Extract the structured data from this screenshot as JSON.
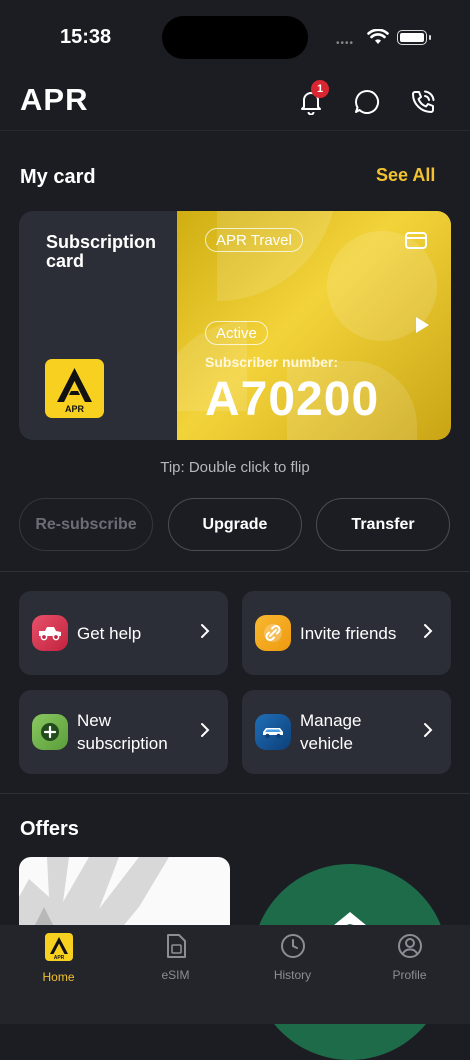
{
  "status_bar": {
    "time": "15:38"
  },
  "header": {
    "title": "APR",
    "notification_count": "1"
  },
  "my_card": {
    "section_title": "My card",
    "see_all": "See All",
    "card_title": "Subscription card",
    "logo_text": "APR",
    "plan_pill": "APR Travel",
    "status_pill": "Active",
    "subscriber_label": "Subscriber number:",
    "subscriber_number": "A70200",
    "tip": "Tip: Double click to flip"
  },
  "actions": {
    "resubscribe": "Re-subscribe",
    "upgrade": "Upgrade",
    "transfer": "Transfer"
  },
  "tiles": {
    "get_help": "Get help",
    "invite_friends": "Invite friends",
    "new_subscription": [
      "New",
      "subscription"
    ],
    "manage_vehicle": [
      "Manage",
      "vehicle"
    ]
  },
  "offers": {
    "title": "Offers"
  },
  "tabbar": {
    "home": "Home",
    "esim": "eSIM",
    "history": "History",
    "profile": "Profile"
  },
  "colors": {
    "accent": "#f2c230",
    "background": "#1b1d23",
    "surface": "#2b2e36",
    "badge": "#d92630"
  }
}
